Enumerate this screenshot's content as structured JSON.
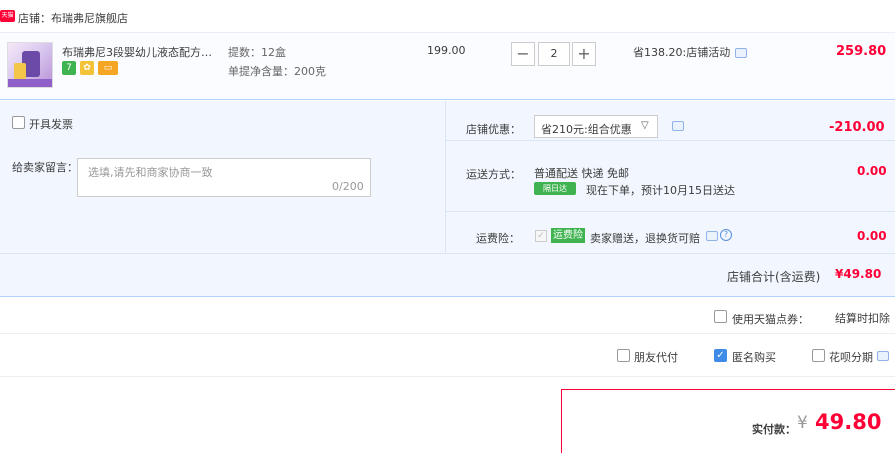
{
  "store": {
    "badge": "天猫",
    "label": "店铺：布瑞弗尼旗舰店"
  },
  "item": {
    "title": "布瑞弗尼3段婴幼儿液态配方奶...",
    "service_icons": [
      "7",
      "gift-icon",
      "card-icon"
    ],
    "attr_count": "提数：12盒",
    "attr_weight": "单提净含量：200克",
    "unit_price": "199.00",
    "quantity": "2",
    "qty_minus": "−",
    "qty_plus": "+",
    "promo": "省138.20:店铺活动",
    "total": "259.80"
  },
  "options": {
    "invoice_label": "开具发票",
    "message_label": "给卖家留言：",
    "message_placeholder": "选填,请先和商家协商一致",
    "message_counter": "0/200",
    "coupon_label": "店铺优惠：",
    "coupon_value": "省210元:组合优惠",
    "coupon_amount": "-210.00",
    "shipping_label": "运送方式：",
    "shipping_method": "普通配送 快递 免邮",
    "shipping_badge": "隔日达",
    "shipping_eta": "现在下单，预计10月15日送达",
    "shipping_cost": "0.00",
    "insurance_label": "运费险：",
    "insurance_badge": "运费险",
    "insurance_desc": "卖家赠送，退换货可赔",
    "insurance_cost": "0.00"
  },
  "subtotal": {
    "label": "店铺合计(含运费)",
    "value": "¥49.80"
  },
  "points": {
    "label": "使用天猫点券：",
    "deduct": "结算时扣除"
  },
  "payment": {
    "friend_pay": "朋友代付",
    "anonymous": "匿名购买",
    "huabei": "花呗分期",
    "anonymous_checked": true
  },
  "total": {
    "label": "实付款：",
    "currency": "¥",
    "value": "49.80"
  },
  "colors": {
    "accent_red": "#ff0036",
    "light_blue_bg": "#f2f7ff",
    "green_badge": "#3fb34f",
    "checkbox_blue": "#3e8be8"
  }
}
